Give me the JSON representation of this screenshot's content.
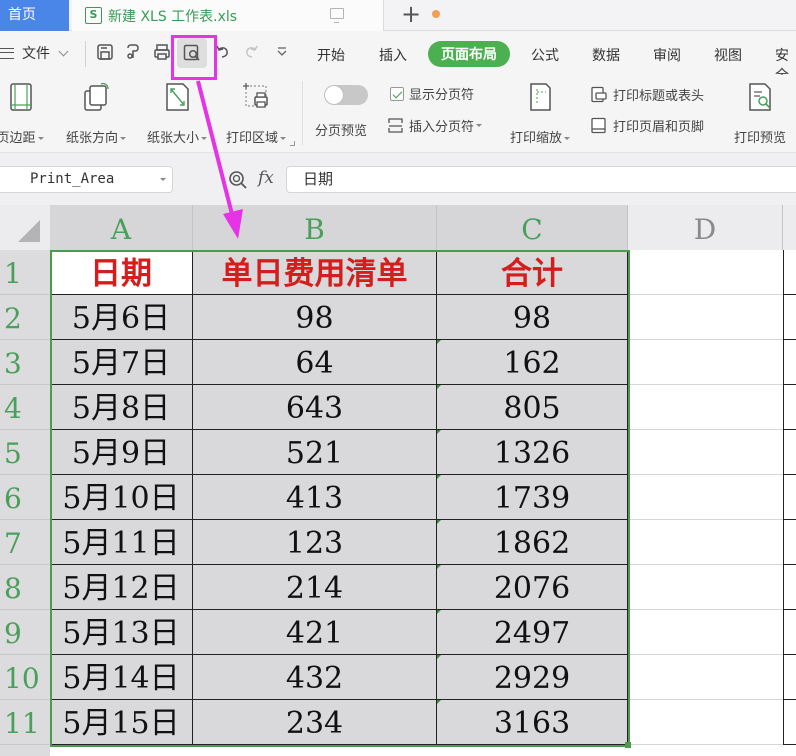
{
  "tabs": {
    "home_label": "首页",
    "file_tab_icon": "S",
    "file_tab_title": "新建 XLS 工作表.xls",
    "monitor_icon": "monitor-icon",
    "unsaved_dot_color": "#f0a050",
    "new_tab_label": "+"
  },
  "menu": {
    "file_label": "文件",
    "quick_access": [
      "save-icon",
      "format-painter-icon",
      "print-icon",
      "print-preview-icon",
      "undo-icon",
      "redo-icon",
      "more-icon"
    ],
    "ribbon_tabs": [
      {
        "label": "开始",
        "active": false
      },
      {
        "label": "插入",
        "active": false
      },
      {
        "label": "页面布局",
        "active": true
      },
      {
        "label": "公式",
        "active": false
      },
      {
        "label": "数据",
        "active": false
      },
      {
        "label": "审阅",
        "active": false
      },
      {
        "label": "视图",
        "active": false
      },
      {
        "label": "安全",
        "active": false
      }
    ],
    "active_color": "#4caf50"
  },
  "ribbon": {
    "margins_label": "页边距",
    "orientation_label": "纸张方向",
    "size_label": "纸张大小",
    "print_area_label": "打印区域",
    "page_break_preview_label": "分页预览",
    "page_break_preview_on": false,
    "show_page_breaks_label": "显示分页符",
    "show_page_breaks_checked": true,
    "insert_page_break_label": "插入分页符",
    "print_scaling_label": "打印缩放",
    "print_titles_label": "打印标题或表头",
    "header_footer_label": "打印页眉和页脚",
    "print_preview_label": "打印预览"
  },
  "formula_bar": {
    "name_box": "Print_Area",
    "fx_label": "fx",
    "formula_value": "日期"
  },
  "sheet": {
    "columns": [
      "A",
      "B",
      "C",
      "D"
    ],
    "rows": [
      "1",
      "2",
      "3",
      "4",
      "5",
      "6",
      "7",
      "8",
      "9",
      "10",
      "11"
    ],
    "header": [
      "日期",
      "单日费用清单",
      "合计"
    ],
    "data": [
      [
        "5月6日",
        "98",
        "98"
      ],
      [
        "5月7日",
        "64",
        "162"
      ],
      [
        "5月8日",
        "643",
        "805"
      ],
      [
        "5月9日",
        "521",
        "1326"
      ],
      [
        "5月10日",
        "413",
        "1739"
      ],
      [
        "5月11日",
        "123",
        "1862"
      ],
      [
        "5月12日",
        "214",
        "2076"
      ],
      [
        "5月13日",
        "421",
        "2497"
      ],
      [
        "5月14日",
        "432",
        "2929"
      ],
      [
        "5月15日",
        "234",
        "3163"
      ]
    ],
    "header_color": "#d41e1e",
    "selection_color": "#4c9a4c",
    "selection_range": "A1:C11"
  },
  "annotation": {
    "color": "#e633e6",
    "target": "print-preview-button"
  }
}
